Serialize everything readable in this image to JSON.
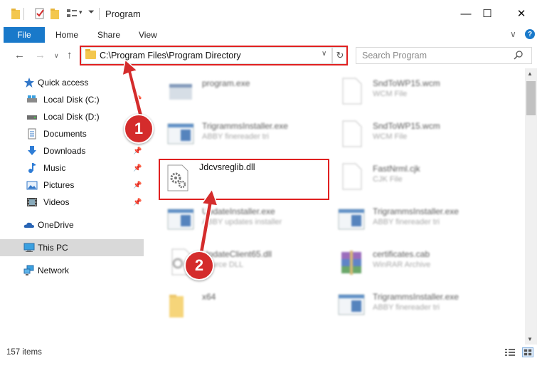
{
  "window": {
    "title": "Program",
    "minimize": "—",
    "maximize": "☐",
    "close": "✕"
  },
  "ribbon": {
    "file": "File",
    "home": "Home",
    "share": "Share",
    "view": "View",
    "expand": "∨",
    "help": "?"
  },
  "address": {
    "path": "C:\\Program Files\\Program Directory",
    "dropdown": "∨",
    "refresh": "↻"
  },
  "search": {
    "placeholder": "Search Program"
  },
  "nav": {
    "back": "←",
    "forward": "→",
    "recent": "∨",
    "up": "↑",
    "quick_access": "Quick access",
    "items": [
      {
        "label": "Local Disk (C:)",
        "pinned": true
      },
      {
        "label": "Local Disk (D:)",
        "pinned": false
      },
      {
        "label": "Documents",
        "pinned": true
      },
      {
        "label": "Downloads",
        "pinned": true
      },
      {
        "label": "Music",
        "pinned": true
      },
      {
        "label": "Pictures",
        "pinned": true
      },
      {
        "label": "Videos",
        "pinned": true
      }
    ],
    "onedrive": "OneDrive",
    "this_pc": "This PC",
    "network": "Network"
  },
  "files": [
    {
      "name": "program.exe",
      "type": ""
    },
    {
      "name": "SndToWP15.wcm",
      "type": "WCM File"
    },
    {
      "name": "TrigrammsInstaller.exe",
      "type": "ABBY finereader tri"
    },
    {
      "name": "SndToWP15.wcm",
      "type": "WCM File"
    },
    {
      "name": "Jdcvsreglib.dll",
      "type": ""
    },
    {
      "name": "FastNrml.cjk",
      "type": "CJK File"
    },
    {
      "name": "UpdateInstaller.exe",
      "type": "ABBY updates installer"
    },
    {
      "name": "TrigrammsInstaller.exe",
      "type": "ABBY finereader tri"
    },
    {
      "name": "UpdateClient65.dll",
      "type": "Source DLL"
    },
    {
      "name": "certificates.cab",
      "type": "WinRAR Archive"
    },
    {
      "name": "x64",
      "type": ""
    },
    {
      "name": "TrigrammsInstaller.exe",
      "type": "ABBY finereader tri"
    }
  ],
  "status": {
    "count": "157 items"
  },
  "annotations": {
    "step1": "1",
    "step2": "2",
    "color": "#d42c2c"
  }
}
